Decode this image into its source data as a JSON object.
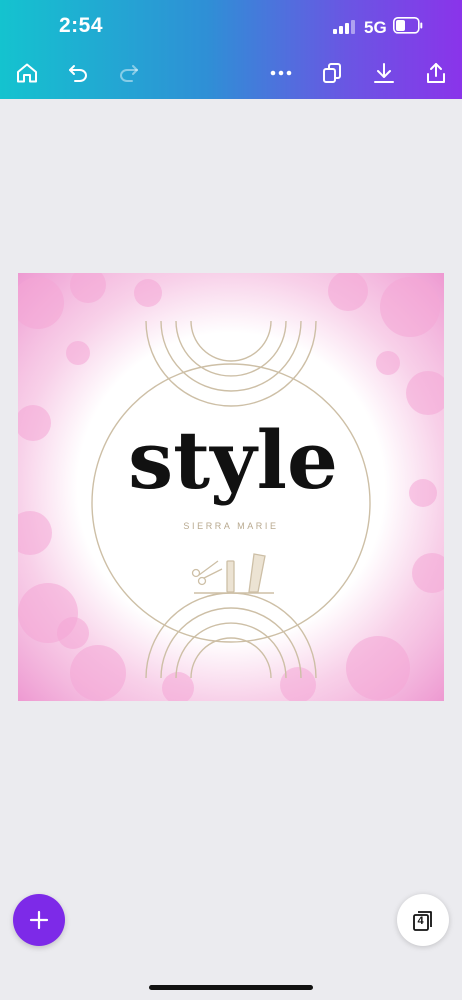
{
  "status_bar": {
    "time": "2:54",
    "network": "5G"
  },
  "toolbar": {
    "home_icon": "home-icon",
    "undo_icon": "undo-icon",
    "redo_icon": "redo-icon",
    "more_icon": "more-icon",
    "duplicate_icon": "duplicate-icon",
    "download_icon": "download-icon",
    "share_icon": "share-icon"
  },
  "design": {
    "headline": "style",
    "subtitle": "SIERRA MARIE",
    "colors": {
      "splash": "#f2a9d6",
      "line": "#cdbfa6",
      "text": "#111111"
    }
  },
  "bottom": {
    "add_icon": "plus-icon",
    "page_count": "4"
  }
}
